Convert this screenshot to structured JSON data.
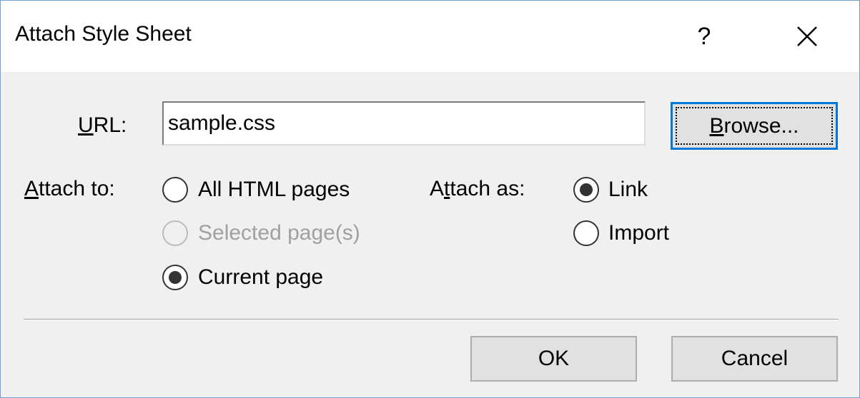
{
  "dialog": {
    "title": "Attach Style Sheet",
    "help_label": "?"
  },
  "url": {
    "label_accel": "U",
    "label_rest": "RL:",
    "value": "sample.css"
  },
  "browse": {
    "label_accel": "B",
    "label_rest": "rowse..."
  },
  "attach_to": {
    "label_accel": "A",
    "label_rest": "ttach to:",
    "options": [
      {
        "label": "All HTML pages",
        "selected": false,
        "disabled": false
      },
      {
        "label": "Selected page(s)",
        "selected": false,
        "disabled": true
      },
      {
        "label": "Current page",
        "selected": true,
        "disabled": false
      }
    ]
  },
  "attach_as": {
    "label_pre": "A",
    "label_accel": "t",
    "label_rest": "tach as:",
    "options": [
      {
        "label": "Link",
        "selected": true
      },
      {
        "label": "Import",
        "selected": false
      }
    ]
  },
  "buttons": {
    "ok": "OK",
    "cancel": "Cancel"
  },
  "colors": {
    "focus_border": "#0078d7",
    "window_border": "#6f9fd8"
  }
}
